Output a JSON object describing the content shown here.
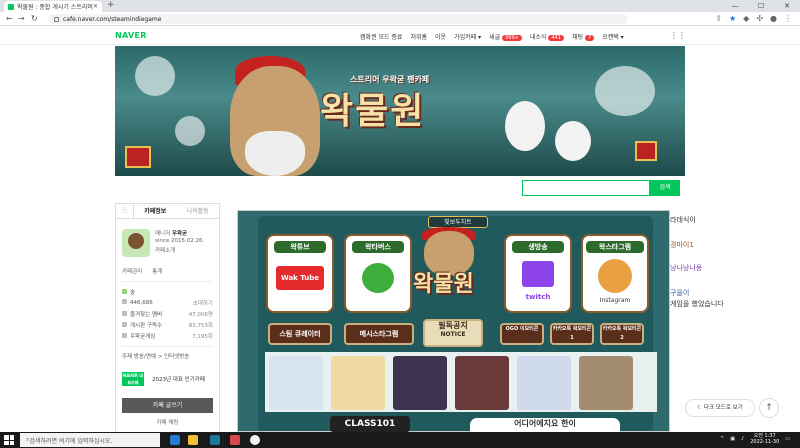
{
  "browser": {
    "tab_title": "왁물원 : 종합 게시기 스트리머 ...",
    "url": "cafe.naver.com/steamindiegame"
  },
  "naver": {
    "logo": "NAVER",
    "gnb": [
      "캠화권 모드 종료",
      "처위홈",
      "이웃",
      "가입카페 ▾",
      "새글",
      "내소식",
      "채팅",
      "오캔택 ▾"
    ],
    "badges": {
      "new_posts": "999+",
      "news": "441",
      "chat": "7"
    }
  },
  "banner": {
    "subtitle": "스트리머 우왁굳 팬카페",
    "title": "왁물원"
  },
  "search": {
    "placeholder": "",
    "button": "검색"
  },
  "sidebar": {
    "tabs": [
      "카페정보",
      "나의활동"
    ],
    "manager_label": "매니저",
    "manager_name": "우왁굳",
    "since": "since 2015.02.26.",
    "cafe_intro": "카페소개",
    "links": [
      "카페관리",
      "통계"
    ],
    "stats": [
      {
        "label": "숲",
        "value": ""
      },
      {
        "label": "446,686",
        "value": "초대하기"
      },
      {
        "label": "즐겨찾는 멤버",
        "value": "47,006명"
      },
      {
        "label": "게시판 구독수",
        "value": "83,753회"
      },
      {
        "label": "우왁굳게임",
        "value": "7,195회"
      }
    ],
    "rules": "주제  방송/연예 > 인터넷방송",
    "award_badge": "NAVER 대표카페",
    "award_text": "2023년 대표 인기카페",
    "join_button": "카페 글쓰기",
    "chat_button": "카페 채팅"
  },
  "art": {
    "top_label": "빛보두치트",
    "signs": [
      {
        "title": "왁튜브",
        "caption": "Wak Tube"
      },
      {
        "title": "왁타버스",
        "caption": ""
      },
      {
        "title": "생방송",
        "caption": "twitch"
      },
      {
        "title": "왁스타그램",
        "caption": "Instagram"
      }
    ],
    "logo": "왁물원",
    "wood": [
      "스팀 큐레이터",
      "메시스타그램",
      "NOTICE",
      "OGO 이모티콘",
      "카카오톡 왁모티콘1",
      "카카오톡 왁모티콘2"
    ],
    "notice_top": "필독공지",
    "class_label": "CLASS101",
    "bottom_label": "어디어에지요 한이"
  },
  "chatlog": [
    {
      "text": "라데식이",
      "color": "#333"
    },
    {
      "text": "경마이1",
      "color": "#a0522d"
    },
    {
      "text": "낭나낭나옹",
      "color": "#7b3ea2"
    },
    {
      "text": "구을이",
      "color": "#2a5aa2"
    },
    {
      "text": "게임을 했었습니다",
      "color": "#333"
    }
  ],
  "floating": {
    "dark_mode": "다크 모드로 보기",
    "top": "↑"
  },
  "taskbar": {
    "search_placeholder": "검색하려면 여기에 입력하십시오.",
    "time": "오전 1:37",
    "date": "2022-11-30"
  }
}
